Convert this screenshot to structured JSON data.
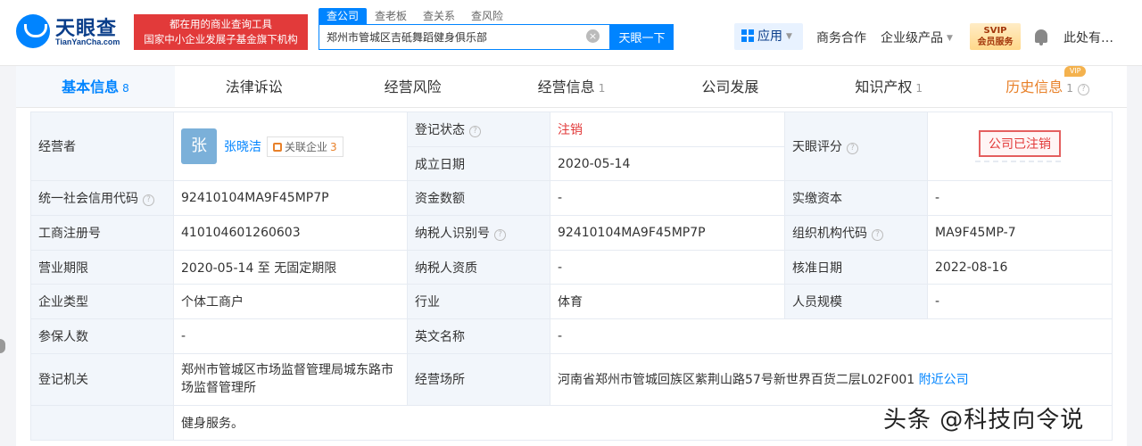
{
  "header": {
    "logo_text": "天眼查",
    "logo_sub": "TianYanCha.com",
    "banner_line1": "都在用的商业查询工具",
    "banner_line2": "国家中小企业发展子基金旗下机构",
    "search_tabs": [
      "查公司",
      "查老板",
      "查关系",
      "查风险"
    ],
    "search_value": "郑州市管城区吉砥舞蹈健身俱乐部",
    "search_clear": "×",
    "search_button": "天眼一下",
    "nav_app": "应用",
    "nav_business": "商务合作",
    "nav_products": "企业级产品",
    "vip_line1": "SVIP",
    "vip_line2": "会员服务",
    "user_name": "此处有…"
  },
  "tabs": [
    {
      "label": "基本信息",
      "count": "8"
    },
    {
      "label": "法律诉讼",
      "count": ""
    },
    {
      "label": "经营风险",
      "count": ""
    },
    {
      "label": "经营信息",
      "count": "1"
    },
    {
      "label": "公司发展",
      "count": ""
    },
    {
      "label": "知识产权",
      "count": "1"
    },
    {
      "label": "历史信息",
      "count": "1",
      "tag": "VIP"
    }
  ],
  "info": {
    "operator_label": "经营者",
    "avatar_char": "张",
    "operator_name": "张晓洁",
    "related_label": "关联企业",
    "related_count": "3",
    "reg_status_label": "登记状态",
    "reg_status_value": "注销",
    "found_date_label": "成立日期",
    "found_date_value": "2020-05-14",
    "score_label": "天眼评分",
    "score_stamp": "公司已注销",
    "credit_code_label": "统一社会信用代码",
    "credit_code_value": "92410104MA9F45MP7P",
    "capital_label": "资金数额",
    "capital_value": "-",
    "paid_capital_label": "实缴资本",
    "paid_capital_value": "-",
    "reg_no_label": "工商注册号",
    "reg_no_value": "410104601260603",
    "taxpayer_id_label": "纳税人识别号",
    "taxpayer_id_value": "92410104MA9F45MP7P",
    "org_code_label": "组织机构代码",
    "org_code_value": "MA9F45MP-7",
    "term_label": "营业期限",
    "term_value": "2020-05-14 至 无固定期限",
    "taxpayer_qual_label": "纳税人资质",
    "taxpayer_qual_value": "-",
    "approve_date_label": "核准日期",
    "approve_date_value": "2022-08-16",
    "type_label": "企业类型",
    "type_value": "个体工商户",
    "industry_label": "行业",
    "industry_value": "体育",
    "staff_label": "人员规模",
    "staff_value": "-",
    "insured_label": "参保人数",
    "insured_value": "-",
    "english_label": "英文名称",
    "english_value": "-",
    "authority_label": "登记机关",
    "authority_value": "郑州市管城区市场监督管理局城东路市场监督管理所",
    "address_label": "经营场所",
    "address_value": "河南省郑州市管城回族区紫荆山路57号新世界百货二层L02F001",
    "nearby_label": "附近公司",
    "scope_value": "健身服务。"
  },
  "watermark": "头条 @科技向令说",
  "colors": {
    "accent": "#0084ff",
    "danger": "#e23a3a",
    "history": "#e8812a"
  }
}
